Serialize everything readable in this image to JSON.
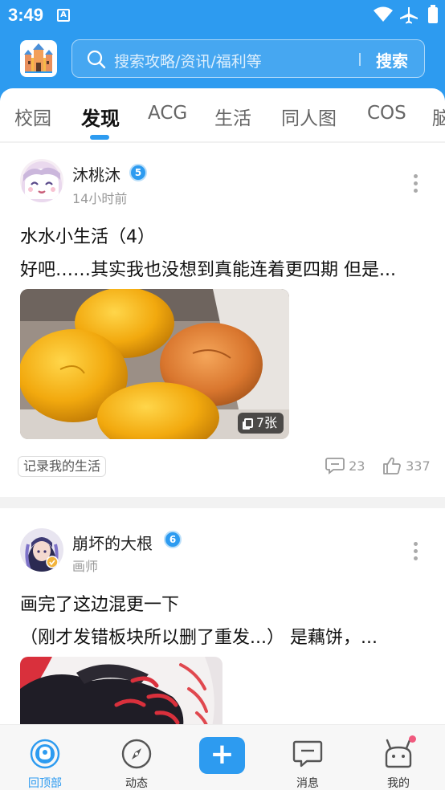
{
  "status": {
    "time": "3:49",
    "notification_icon": "A"
  },
  "header": {
    "search_placeholder": "搜索攻略/资讯/福利等",
    "search_button": "搜索"
  },
  "tabs": [
    {
      "label": "校园"
    },
    {
      "label": "发现",
      "active": true
    },
    {
      "label": "ACG"
    },
    {
      "label": "生活"
    },
    {
      "label": "同人图"
    },
    {
      "label": "COS"
    },
    {
      "label": "脑"
    }
  ],
  "posts": [
    {
      "author": "沐桃沐",
      "level": "5",
      "meta": "14小时前",
      "title": "水水小生活（4）",
      "excerpt": "好吧……其实我也没想到真能连着更四期 但是...",
      "image_count": "7张",
      "tag": "记录我的生活",
      "comments": "23",
      "likes": "337"
    },
    {
      "author": "崩坏的大根",
      "level": "6",
      "meta": "画师",
      "title": "画完了这边混更一下",
      "excerpt": "（刚才发错板块所以删了重发...） 是藕饼，..."
    }
  ],
  "bottom_nav": [
    {
      "label": "回顶部",
      "icon": "back-to-top-icon",
      "active": true
    },
    {
      "label": "动态",
      "icon": "compass-icon"
    },
    {
      "label": "+",
      "icon": "plus-icon"
    },
    {
      "label": "消息",
      "icon": "message-icon"
    },
    {
      "label": "我的",
      "icon": "profile-robot-icon"
    }
  ],
  "colors": {
    "accent": "#2d9bf0",
    "badge_dot": "#f05a7e"
  }
}
